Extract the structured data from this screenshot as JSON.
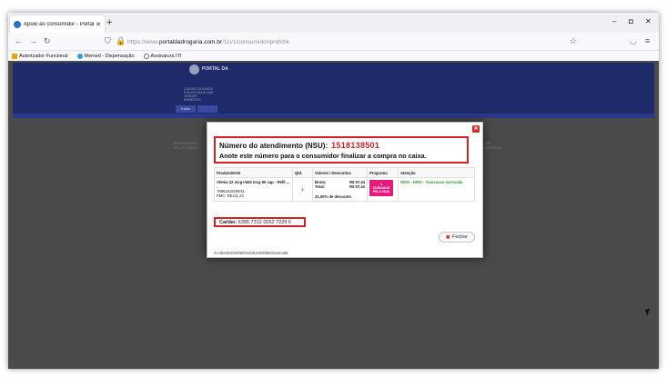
{
  "browser": {
    "tab_title": "Apoio ao consumidor - Portal d",
    "tab_close": "✕",
    "new_tab": "+",
    "url_prefix": "https://www.",
    "url_domain": "portaldadrogaria.com.br",
    "url_path": "/11v1/consumidor/prd/chk",
    "bookmarks": [
      {
        "label": "Autorizador Funcional",
        "color": "#e8a400"
      },
      {
        "label": "Memed - Dispensação",
        "color": "#2aa1d8"
      },
      {
        "label": "Assinatura ITI",
        "color": "#6a6a6a"
      }
    ],
    "window_minimize": "–",
    "window_maximize": "◘",
    "window_close": "✕"
  },
  "portal": {
    "logo_text": "PORTAL DA",
    "logo_subtitle": "CUIDAR DA SAÚDE É MUITO MAIS QUE VENDER REMÉDIOS",
    "menu_first": "Início",
    "bg_label_left": "Atendimento\nPor Produto",
    "bg_label_right": "de\nAtendimento"
  },
  "modal": {
    "close_label": "✕",
    "nsu_label": "Número do atendimento (NSU):",
    "nsu_number": "1518138501",
    "nsu_instruction": "Anote este número para o consumidor finalizar a compra no caixa.",
    "table": {
      "headers": [
        "Produto/EAN",
        "Qtd.",
        "Valores / Descontos",
        "Programa",
        "Atenção"
      ],
      "row": {
        "product_name": "Alenia 12 mcg+/400 mcg 60 cap - Refil ... .",
        "ean": "7896181919943",
        "pmc": "PMC: R$141,23",
        "qty": "1",
        "bruto_label": "Bruto:",
        "bruto_value": "R$ 97,44",
        "total_label": "Total:",
        "total_value": "R$ 97,44",
        "discount": "31,00% de desconto",
        "program_name": "CUIDADOS PELA VIDA",
        "attention": "N000 - N000 - Transacao Aprovada"
      }
    },
    "card_label": "Cartão:",
    "card_number": "6395 7312 0052 7229 6",
    "close_button": "Fechar",
    "close_button_icon": "✖",
    "footer_code": "XA39232202008074206100008601tarma68"
  },
  "colors": {
    "header_navy": "#1f2a6a",
    "highlight_red": "#d91f26",
    "program_pink": "#e6197d",
    "attention_green": "#2e9b2e"
  }
}
